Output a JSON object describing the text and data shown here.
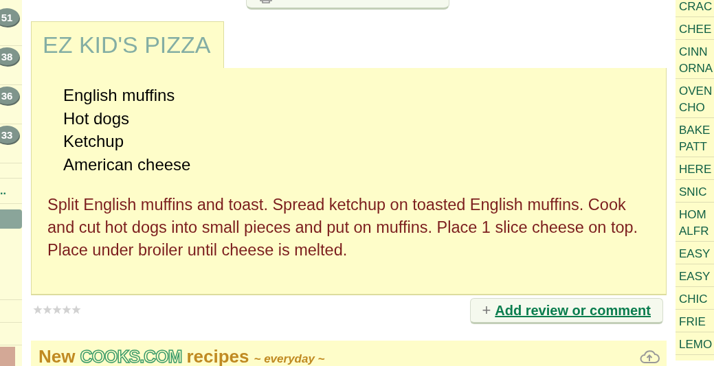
{
  "left_rail": {
    "badges": [
      "51",
      "38",
      "36",
      "33"
    ],
    "more_link": ".."
  },
  "recipe": {
    "title": "EZ KID'S PIZZA",
    "ingredients": [
      "English muffins",
      "Hot dogs",
      "Ketchup",
      "American cheese"
    ],
    "instructions": "Split English muffins and toast. Spread ketchup on toasted English muffins. Cook and cut hot dogs into small pieces and put on muffins. Place 1 slice cheese on top. Place under broiler until cheese is melted.",
    "stars": 0,
    "review_button": {
      "icon": "+",
      "label": "Add review or comment"
    }
  },
  "new_recipes": {
    "prefix": "New",
    "logo": "COOKS.COM",
    "suffix": "recipes",
    "tagline": "~ everyday ~"
  },
  "right_list": [
    {
      "lines": [
        "CRAC"
      ]
    },
    {
      "lines": [
        "CHEE"
      ]
    },
    {
      "lines": [
        "CINN",
        "ORNA"
      ]
    },
    {
      "lines": [
        "OVEN",
        "CHO"
      ]
    },
    {
      "lines": [
        "BAKE",
        "PATT"
      ]
    },
    {
      "lines": [
        "HERE"
      ]
    },
    {
      "lines": [
        "SNIC"
      ]
    },
    {
      "lines": [
        "HOM",
        "ALFR"
      ]
    },
    {
      "lines": [
        "EASY"
      ]
    },
    {
      "lines": [
        "EASY"
      ]
    },
    {
      "lines": [
        "CHIC"
      ]
    },
    {
      "lines": [
        "FRIE"
      ]
    },
    {
      "lines": [
        "LEMO"
      ]
    }
  ]
}
